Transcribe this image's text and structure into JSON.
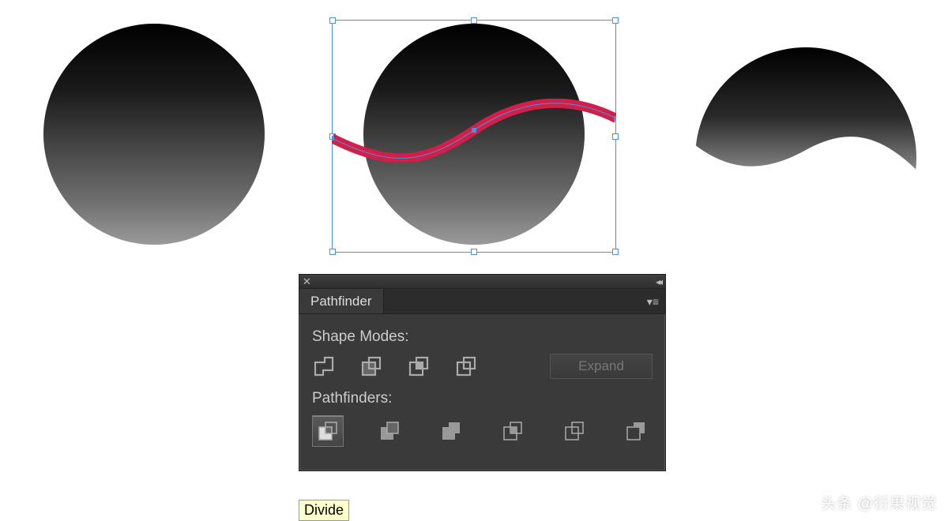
{
  "panel": {
    "title": "Pathfinder",
    "section_shape_modes": "Shape Modes:",
    "section_pathfinders": "Pathfinders:",
    "expand_label": "Expand",
    "shape_modes": [
      {
        "name": "unite"
      },
      {
        "name": "minus-front"
      },
      {
        "name": "intersect"
      },
      {
        "name": "exclude"
      }
    ],
    "pathfinders": [
      {
        "name": "divide",
        "selected": true
      },
      {
        "name": "trim"
      },
      {
        "name": "merge"
      },
      {
        "name": "crop"
      },
      {
        "name": "outline"
      },
      {
        "name": "minus-back"
      }
    ]
  },
  "tooltip": "Divide",
  "watermark": "头条 @衍果视觉",
  "artboard": {
    "shapes": [
      {
        "name": "gradient-circle"
      },
      {
        "name": "gradient-circle-with-wave-selected"
      },
      {
        "name": "divided-top-piece"
      }
    ]
  }
}
